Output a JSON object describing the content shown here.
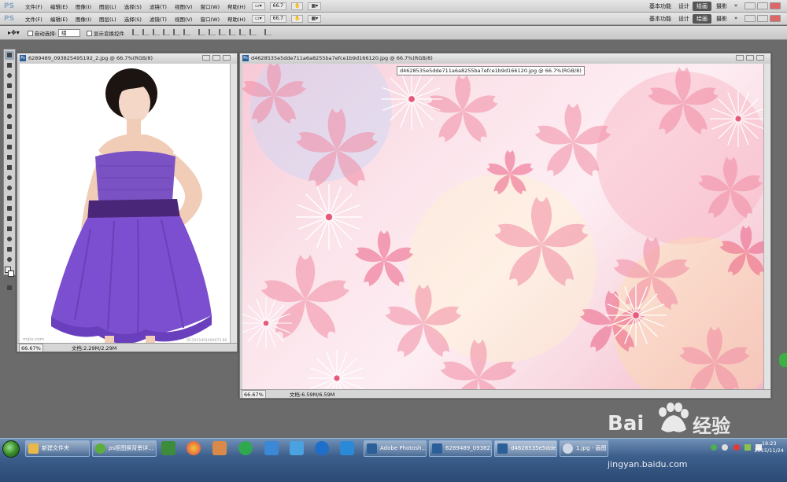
{
  "app": {
    "logo": "PS",
    "menus": [
      "文件(F)",
      "编辑(E)",
      "图像(I)",
      "图层(L)",
      "选择(S)",
      "滤镜(T)",
      "视图(V)",
      "窗口(W)",
      "帮助(H)"
    ],
    "zoom_level": "66.7",
    "workspaces": [
      "基本功能",
      "设计",
      "绘画",
      "摄影"
    ],
    "active_workspace": "绘画",
    "more": "»"
  },
  "options_bar": {
    "auto_select_label": "自动选择:",
    "auto_select_value": "组",
    "show_transform_label": "显示变换控件"
  },
  "doc1": {
    "title": "6289489_093825495192_2.jpg @ 66.7%(RGB/8)",
    "zoom": "66.67%",
    "status": "文档:2.29M/2.29M",
    "watermark_left": "mijiu.com",
    "watermark_right": "RF:2011001000073 60"
  },
  "doc2": {
    "title": "d4628535e5dde711a6a8255ba7efce1b9d166120.jpg @ 66.7%(RGB/8)",
    "tooltip": "d4628535e5dde711a6a8255ba7efce1b9d166120.jpg @ 66.7%(RGB/8)",
    "zoom": "66.67%",
    "status": "文档:6.59M/6.59M"
  },
  "taskbar": {
    "items": [
      {
        "label": "新建文件夹",
        "color": "#e8b84a"
      },
      {
        "label": "ps抠图换背景详...",
        "color": "#5cae3c"
      },
      {
        "label": "Adobe Photosh...",
        "color": "#2a5f9a"
      },
      {
        "label": "6289489_09382...",
        "color": "#2a5f9a"
      },
      {
        "label": "d4628535e5dde...",
        "color": "#2a5f9a"
      },
      {
        "label": "1.jpg - 画图",
        "color": "#cfd8e6"
      }
    ],
    "time": "19:23",
    "date": "2015/11/24"
  },
  "watermark": {
    "brand": "Bai",
    "brand_cn": "经验",
    "url": "jingyan.baidu.com"
  }
}
